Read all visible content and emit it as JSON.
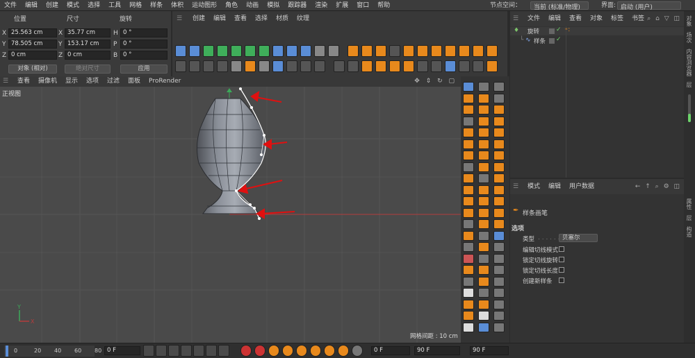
{
  "menubar": {
    "items": [
      "文件",
      "编辑",
      "创建",
      "模式",
      "选择",
      "工具",
      "网格",
      "样条",
      "体积",
      "运动图形",
      "角色",
      "动画",
      "模拟",
      "跟踪器",
      "渲染",
      "扩展",
      "窗口",
      "帮助"
    ],
    "node_space_label": "节点空间：",
    "node_space_value": "当前 (标准/物理)",
    "interface_label": "界面:",
    "interface_value": "启动 (用户)"
  },
  "coords": {
    "headers": {
      "position": "位置",
      "size": "尺寸",
      "rotation": "旋转"
    },
    "rows": [
      {
        "axis": "X",
        "pos": "25.563 cm",
        "size_axis": "X",
        "size": "35.77 cm",
        "rot_axis": "H",
        "rot": "0 °"
      },
      {
        "axis": "Y",
        "pos": "78.505 cm",
        "size_axis": "Y",
        "size": "153.17 cm",
        "rot_axis": "P",
        "rot": "0 °"
      },
      {
        "axis": "Z",
        "pos": "0 cm",
        "size_axis": "Z",
        "size": "0 cm",
        "rot_axis": "B",
        "rot": "0 °"
      }
    ],
    "mode": "对象 (相对)",
    "size_mode": "绝对尺寸",
    "apply": "应用"
  },
  "tool_menu": [
    "创建",
    "编辑",
    "查看",
    "选择",
    "材质",
    "纹理"
  ],
  "viewport": {
    "menu": [
      "查看",
      "摄像机",
      "显示",
      "选项",
      "过滤",
      "面板",
      "ProRender"
    ],
    "view_label": "正视图",
    "grid_spacing": "网格间距 : 10 cm",
    "axis_x": "X",
    "axis_y": "Y"
  },
  "object_manager": {
    "menu": [
      "文件",
      "编辑",
      "查看",
      "对象",
      "标签",
      "书签"
    ],
    "objects": [
      {
        "name": "旋转",
        "color": "#e8a33d"
      },
      {
        "name": "样条",
        "color": "#e8a33d"
      }
    ]
  },
  "attribute_manager": {
    "menu": [
      "模式",
      "编辑",
      "用户数据"
    ],
    "tool_name": "样条画笔",
    "section": "选项",
    "type_label": "类型",
    "type_value": "贝塞尔",
    "options": [
      "编辑切线模式",
      "锁定切线旋转",
      "锁定切线长度",
      "创建新样条"
    ]
  },
  "side_tabs": [
    "对象",
    "场次",
    "内容浏览器",
    "层"
  ],
  "side_tabs_lower": [
    "属性",
    "层",
    "构造"
  ],
  "timeline": {
    "ticks": [
      "0",
      "20",
      "40",
      "60",
      "80"
    ],
    "current_frame": "0 F",
    "start_frame": "0 F",
    "end_frame": "90 F",
    "max_frame": "90 F"
  },
  "colors": {
    "accent_orange": "#e8891c",
    "annotation_red": "#e01010",
    "selection_blue": "#5a8dd6"
  }
}
